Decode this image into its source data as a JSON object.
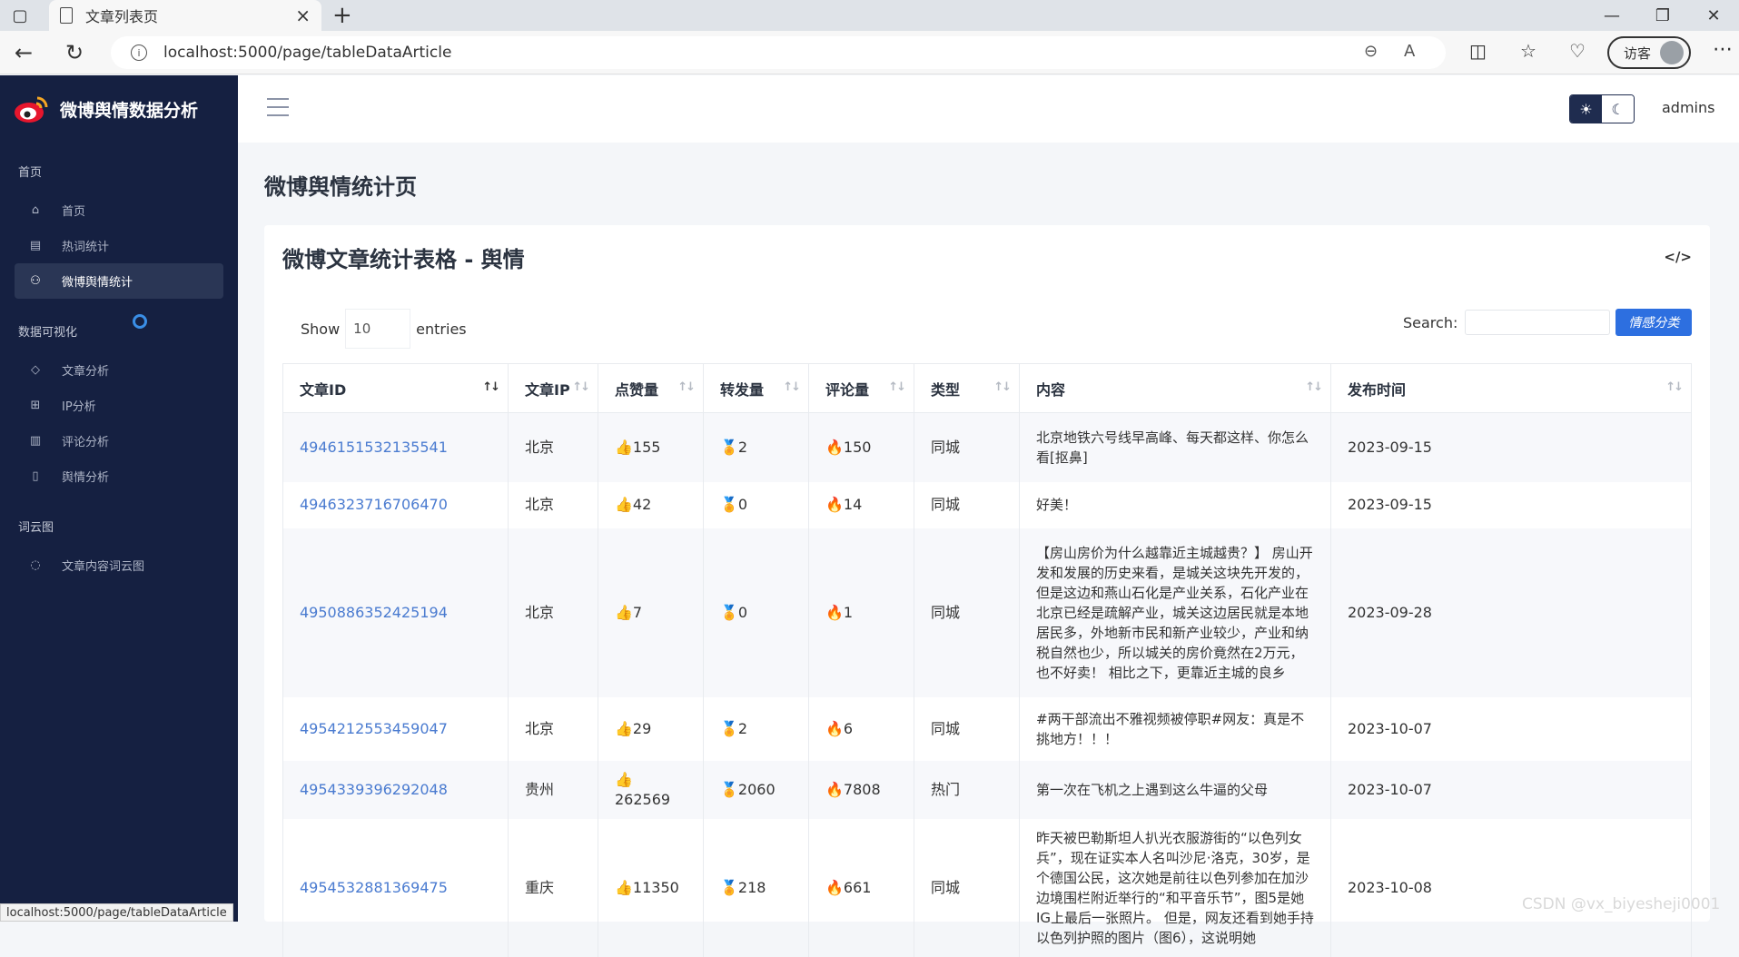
{
  "browser": {
    "tab_title": "文章列表页",
    "url": "localhost:5000/page/tableDataArticle",
    "visitor_label": "访客",
    "status_url": "localhost:5000/page/tableDataArticle"
  },
  "brand": "微博舆情数据分析",
  "sidebar": {
    "sections": [
      {
        "title": "首页",
        "items": [
          {
            "label": "首页",
            "icon": "home-icon"
          },
          {
            "label": "热词统计",
            "icon": "keyboard-icon"
          },
          {
            "label": "微博舆情统计",
            "icon": "users-icon",
            "active": true
          }
        ]
      },
      {
        "title": "数据可视化",
        "items": [
          {
            "label": "文章分析",
            "icon": "tag-icon"
          },
          {
            "label": "IP分析",
            "icon": "cart-icon"
          },
          {
            "label": "评论分析",
            "icon": "chart-icon"
          },
          {
            "label": "舆情分析",
            "icon": "clipboard-icon"
          }
        ]
      },
      {
        "title": "词云图",
        "items": [
          {
            "label": "文章内容词云图",
            "icon": "chat-icon"
          }
        ]
      }
    ]
  },
  "topbar": {
    "user": "admins"
  },
  "page": {
    "title": "微博舆情统计页",
    "card_title": "微博文章统计表格 - 舆情",
    "show_label": "Show",
    "entries_value": "10",
    "entries_label": "entries",
    "search_label": "Search:",
    "classify_button": "情感分类"
  },
  "table": {
    "headers": [
      "文章ID",
      "文章IP",
      "点赞量",
      "转发量",
      "评论量",
      "类型",
      "内容",
      "发布时间"
    ],
    "rows": [
      {
        "id": "4946151532135541",
        "ip": "北京",
        "likes": "155",
        "reposts": "2",
        "comments": "150",
        "type": "同城",
        "content": "北京地铁六号线早高峰、每天都这样、你怎么看[抠鼻]",
        "date": "2023-09-15"
      },
      {
        "id": "4946323716706470",
        "ip": "北京",
        "likes": "42",
        "reposts": "0",
        "comments": "14",
        "type": "同城",
        "content": "好美！",
        "date": "2023-09-15"
      },
      {
        "id": "4950886352425194",
        "ip": "北京",
        "likes": "7",
        "reposts": "0",
        "comments": "1",
        "type": "同城",
        "content": "【房山房价为什么越靠近主城越贵？】 房山开发和发展的历史来看，是城关这块先开发的，但是这边和燕山石化是产业关系，石化产业在北京已经是疏解产业，城关这边居民就是本地居民多，外地新市民和新产业较少，产业和纳税自然也少，所以城关的房价竟然在2万元，也不好卖！ 相比之下，更靠近主城的良乡",
        "date": "2023-09-28"
      },
      {
        "id": "4954212553459047",
        "ip": "北京",
        "likes": "29",
        "reposts": "2",
        "comments": "6",
        "type": "同城",
        "content": "#两干部流出不雅视频被停职#网友：真是不挑地方！！！",
        "date": "2023-10-07"
      },
      {
        "id": "4954339396292048",
        "ip": "贵州",
        "likes": "262569",
        "reposts": "2060",
        "comments": "7808",
        "type": "热门",
        "content": "第一次在飞机之上遇到这么牛逼的父母",
        "date": "2023-10-07"
      },
      {
        "id": "4954532881369475",
        "ip": "重庆",
        "likes": "11350",
        "reposts": "218",
        "comments": "661",
        "type": "同城",
        "content": "昨天被巴勒斯坦人扒光衣服游街的“以色列女兵”，现在证实本人名叫沙尼·洛克，30岁，是个德国公民，这次她是前往以色列参加在加沙边境围栏附近举行的“和平音乐节”，图5是她IG上最后一张照片。 但是，网友还看到她手持以色列护照的图片（图6），这说明她",
        "date": "2023-10-08"
      }
    ]
  },
  "watermark": "CSDN @vx_biyesheji0001"
}
